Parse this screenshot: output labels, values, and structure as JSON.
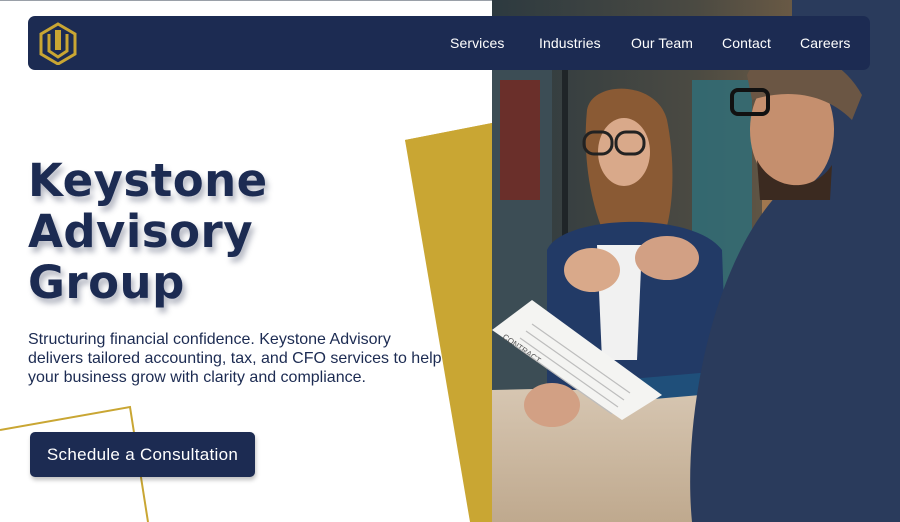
{
  "brand": {
    "logo_icon": "keystone-shield-logo-icon",
    "accent": "#c9a633",
    "primary": "#1c2b52"
  },
  "nav": {
    "items": [
      {
        "label": "Services"
      },
      {
        "label": "Industries"
      },
      {
        "label": "Our Team"
      },
      {
        "label": "Contact"
      },
      {
        "label": "Careers"
      }
    ]
  },
  "hero": {
    "title_lines": [
      "Keystone",
      "Advisory",
      "Group"
    ],
    "description": "Structuring financial confidence. Keystone Advisory delivers tailored accounting, tax, and CFO services to help your business grow with clarity and compliance.",
    "cta_label": "Schedule a Consultation"
  },
  "photo": {
    "document_heading": "CONTRACT"
  }
}
